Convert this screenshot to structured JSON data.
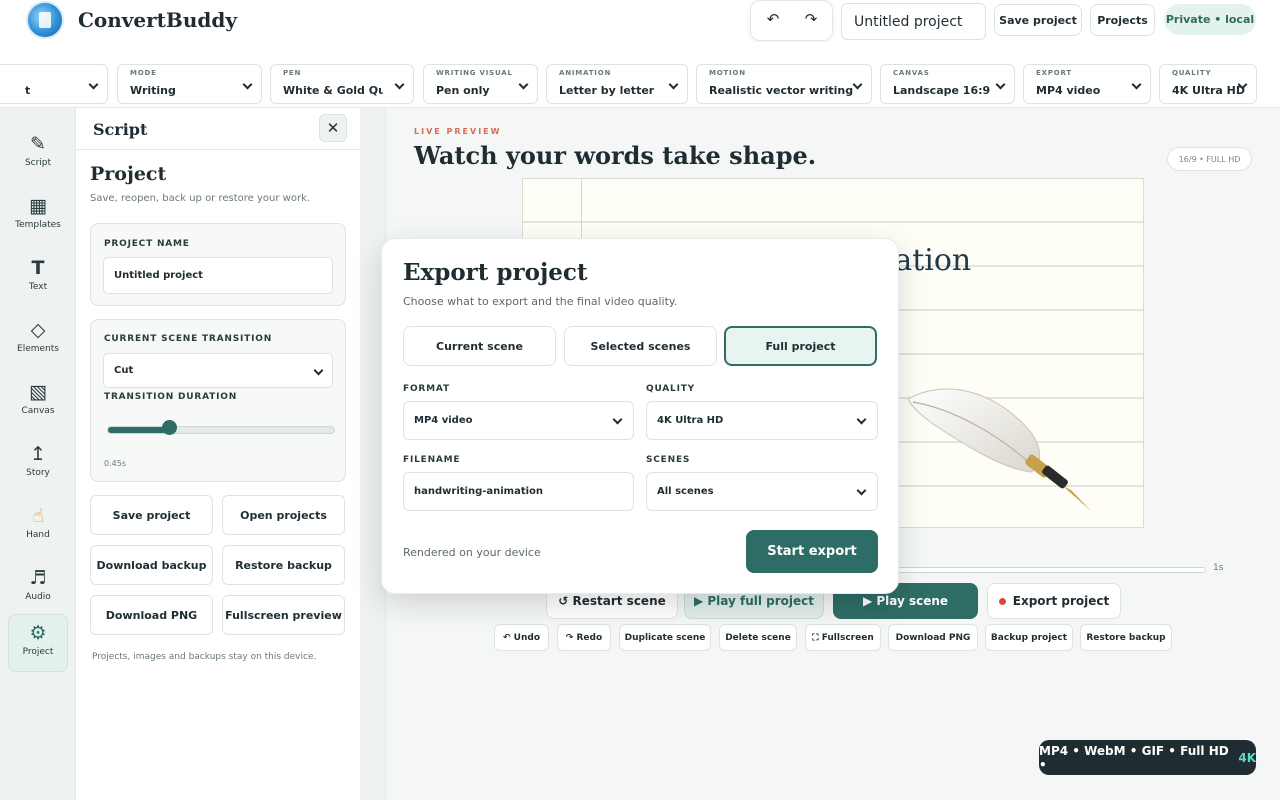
{
  "header": {
    "brand": "ConvertBuddy",
    "undo_icon": "↶",
    "redo_icon": "↷",
    "project_title_value": "Untitled project",
    "save_label": "Save project",
    "projects_label": "Projects",
    "privacy_badge": "Private • local"
  },
  "toolbar": {
    "items": [
      {
        "label": "",
        "value": "t"
      },
      {
        "label": "Mode",
        "value": "Writing"
      },
      {
        "label": "Pen",
        "value": "White & Gold Qui"
      },
      {
        "label": "Writing visual",
        "value": "Pen only"
      },
      {
        "label": "Animation",
        "value": "Letter by letter"
      },
      {
        "label": "Motion",
        "value": "Realistic vector writing"
      },
      {
        "label": "Canvas",
        "value": "Landscape 16:9"
      },
      {
        "label": "Export",
        "value": "MP4 video"
      },
      {
        "label": "Quality",
        "value": "4K Ultra HD"
      }
    ]
  },
  "rail": {
    "items": [
      {
        "icon": "✎",
        "label": "Script"
      },
      {
        "icon": "▦",
        "label": "Templates"
      },
      {
        "icon": "T",
        "label": "Text"
      },
      {
        "icon": "◇",
        "label": "Elements"
      },
      {
        "icon": "▧",
        "label": "Canvas"
      },
      {
        "icon": "↥",
        "label": "Story"
      },
      {
        "icon": "☝",
        "label": "Hand"
      },
      {
        "icon": "♬",
        "label": "Audio"
      },
      {
        "icon": "⚙",
        "label": "Project"
      }
    ],
    "active_index": 8
  },
  "panel": {
    "title": "Script",
    "close_icon": "✕",
    "project_title": "Project",
    "project_sub": "Save, reopen, back up or restore your work.",
    "name_label": "Project name",
    "name_value": "Untitled project",
    "transition_label": "Current scene transition",
    "transition_value": "Cut",
    "duration_label": "Transition duration",
    "duration_value": "0.45s",
    "duration_fraction": 0.27,
    "buttons": [
      "Save project",
      "Open projects",
      "Download backup",
      "Restore backup",
      "Download PNG",
      "Fullscreen preview"
    ],
    "footer": "Projects, images and backups stay on this device."
  },
  "main": {
    "live_label": "LIVE PREVIEW",
    "title": "Watch your words take shape.",
    "canvas_badge": "16/9 • FULL HD",
    "paper_text": "nation",
    "timeline_end": "1s",
    "actions": {
      "restart": "↺ Restart scene",
      "play_full": "▶ Play full project",
      "play_scene": "▶  Play scene",
      "export": "Export project"
    },
    "small_actions": [
      "↶ Undo",
      "↷ Redo",
      "Duplicate scene",
      "Delete scene",
      "⛶ Fullscreen",
      "Download PNG",
      "Backup project",
      "Restore backup"
    ]
  },
  "format_badge": {
    "text": "MP4 • WebM • GIF • Full HD •",
    "accent": "4K"
  },
  "modal": {
    "title": "Export project",
    "subtitle": "Choose what to export and the final video quality.",
    "scope_options": [
      "Current scene",
      "Selected scenes",
      "Full project"
    ],
    "selected_scope": 2,
    "format_label": "Format",
    "format_value": "MP4 video",
    "quality_label": "Quality",
    "quality_value": "4K Ultra HD",
    "filename_label": "Filename",
    "filename_value": "handwriting-animation",
    "scenes_label": "Scenes",
    "scenes_value": "All scenes",
    "footnote": "Rendered on your device",
    "start_label": "Start export"
  },
  "colors": {
    "accent": "#2e6d66",
    "record_red": "#d9483b",
    "live_label": "#d66b5a"
  }
}
